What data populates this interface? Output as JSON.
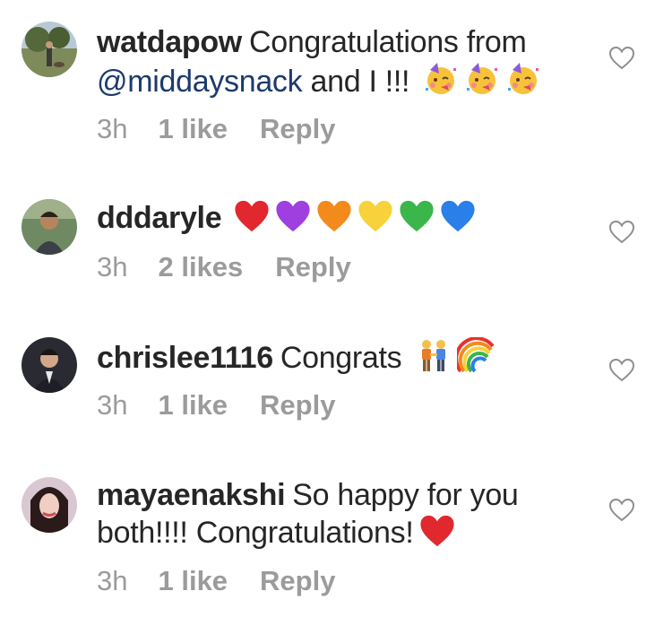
{
  "comments": [
    {
      "username": "watdapow",
      "text_before": "Congratulations from",
      "mention": "@middaysnack",
      "text_after": "and I !!!",
      "emojis": [
        "partying-face-emoji",
        "partying-face-emoji",
        "partying-face-emoji"
      ],
      "time": "3h",
      "likes": "1 like",
      "reply": "Reply"
    },
    {
      "username": "dddaryle",
      "text": "",
      "emojis": [
        "red-heart-emoji",
        "purple-heart-emoji",
        "orange-heart-emoji",
        "yellow-heart-emoji",
        "green-heart-emoji",
        "blue-heart-emoji"
      ],
      "time": "3h",
      "likes": "2 likes",
      "reply": "Reply"
    },
    {
      "username": "chrislee1116",
      "text": "Congrats",
      "emojis": [
        "two-men-holding-hands-emoji",
        "rainbow-emoji"
      ],
      "time": "3h",
      "likes": "1 like",
      "reply": "Reply"
    },
    {
      "username": "mayaenakshi",
      "text": "So happy for you both!!!! Congratulations!",
      "emojis": [
        "red-heart-emoji"
      ],
      "time": "3h",
      "likes": "1 like",
      "reply": "Reply"
    }
  ],
  "colors": {
    "text": "#262626",
    "meta": "#9b9b9b",
    "mention": "#1c3a6e",
    "heart_outline": "#8e8e8e"
  },
  "icons": {
    "like": "heart-outline-icon"
  }
}
